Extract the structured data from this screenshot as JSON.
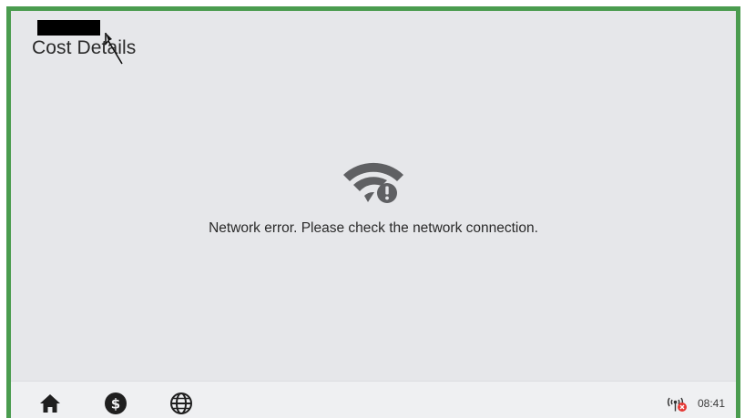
{
  "header": {
    "title": "Cost Details"
  },
  "main": {
    "error_icon": "wifi-error-icon",
    "error_message": "Network error. Please check the network connection."
  },
  "bottom_bar": {
    "nav_items": [
      {
        "icon": "home-icon"
      },
      {
        "icon": "dollar-icon"
      },
      {
        "icon": "globe-icon"
      }
    ],
    "status_icon": "signal-disconnected-icon",
    "time": "08:41"
  },
  "colors": {
    "frame_border": "#4a9c4f",
    "background": "#e6e7ea",
    "icon_gray": "#5f6063",
    "alert_red": "#e53935"
  }
}
